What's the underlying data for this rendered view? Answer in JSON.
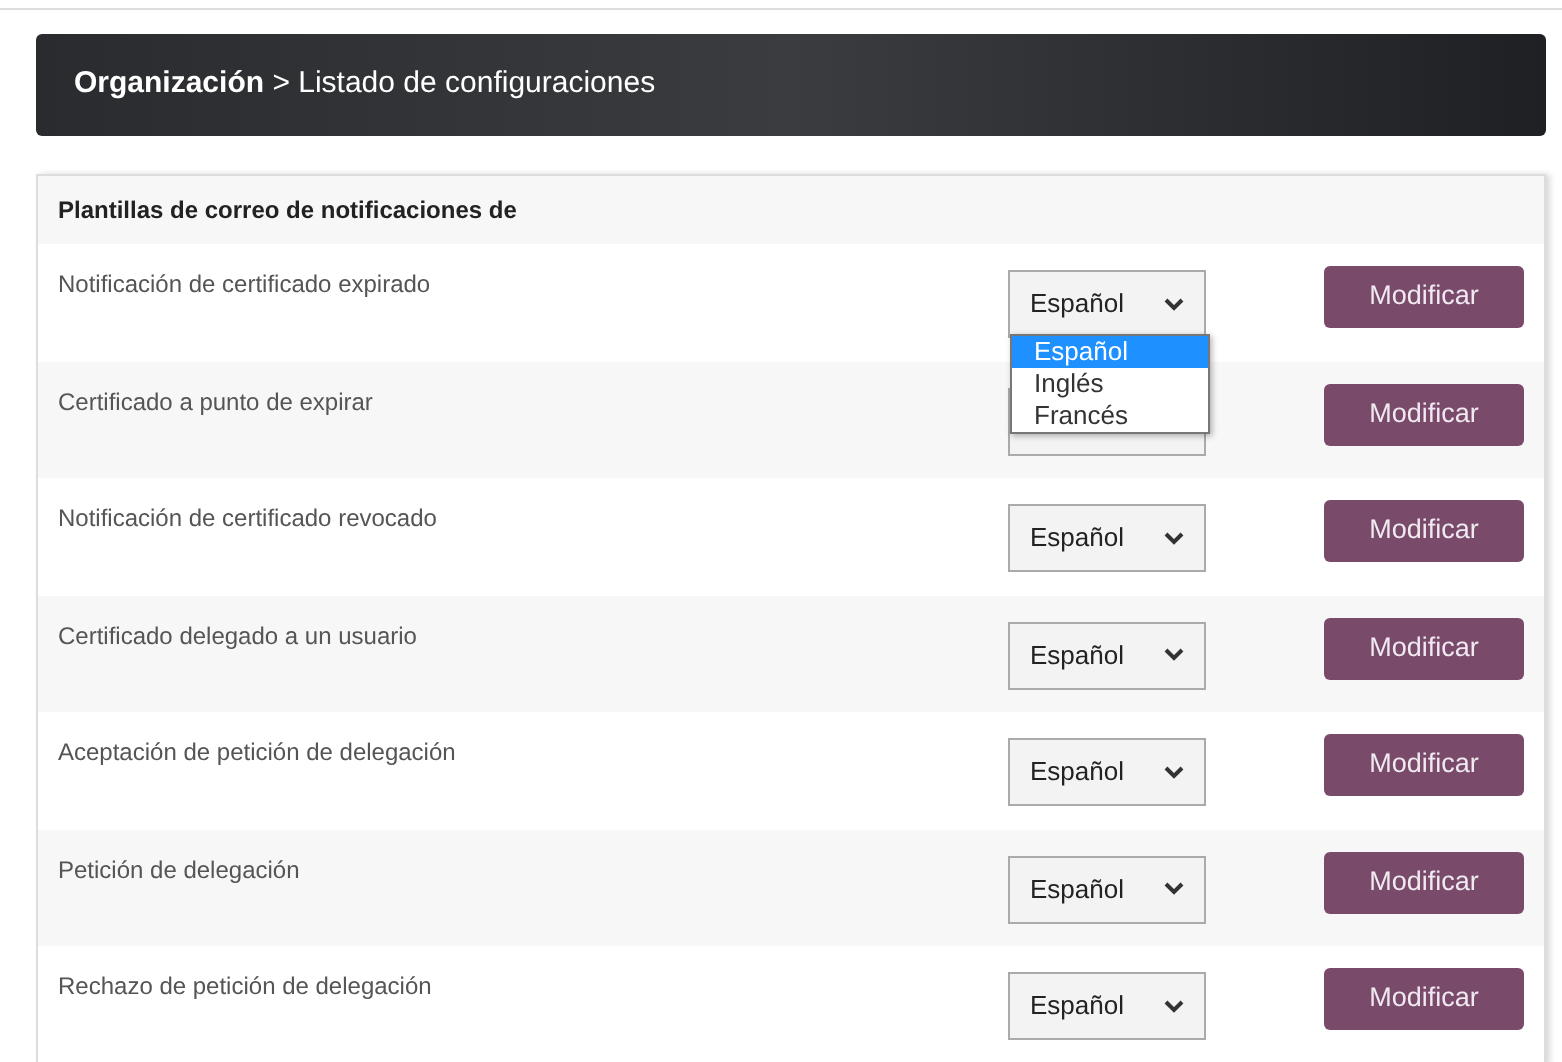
{
  "breadcrumb": {
    "parent": "Organización",
    "separator": ">",
    "current": "Listado de configuraciones"
  },
  "section_title": "Plantillas de correo de notificaciones de",
  "rows": [
    {
      "label": "Notificación de certificado expirado",
      "language": "Español",
      "button": "Modificar",
      "dropdown_open": true
    },
    {
      "label": "Certificado a punto de expirar",
      "button": "Modificar",
      "dropdown_open": false
    },
    {
      "label": "Notificación de certificado revocado",
      "language": "Español",
      "button": "Modificar",
      "dropdown_open": false
    },
    {
      "label": "Certificado delegado a un usuario",
      "language": "Español",
      "button": "Modificar",
      "dropdown_open": false
    },
    {
      "label": "Aceptación de petición de delegación",
      "language": "Español",
      "button": "Modificar",
      "dropdown_open": false
    },
    {
      "label": "Petición de delegación",
      "language": "Español",
      "button": "Modificar",
      "dropdown_open": false
    },
    {
      "label": "Rechazo de petición de delegación",
      "language": "Español",
      "button": "Modificar",
      "dropdown_open": false
    }
  ],
  "dropdown_options": [
    {
      "label": "Español",
      "selected": true
    },
    {
      "label": "Inglés",
      "selected": false
    },
    {
      "label": "Francés",
      "selected": false
    }
  ]
}
